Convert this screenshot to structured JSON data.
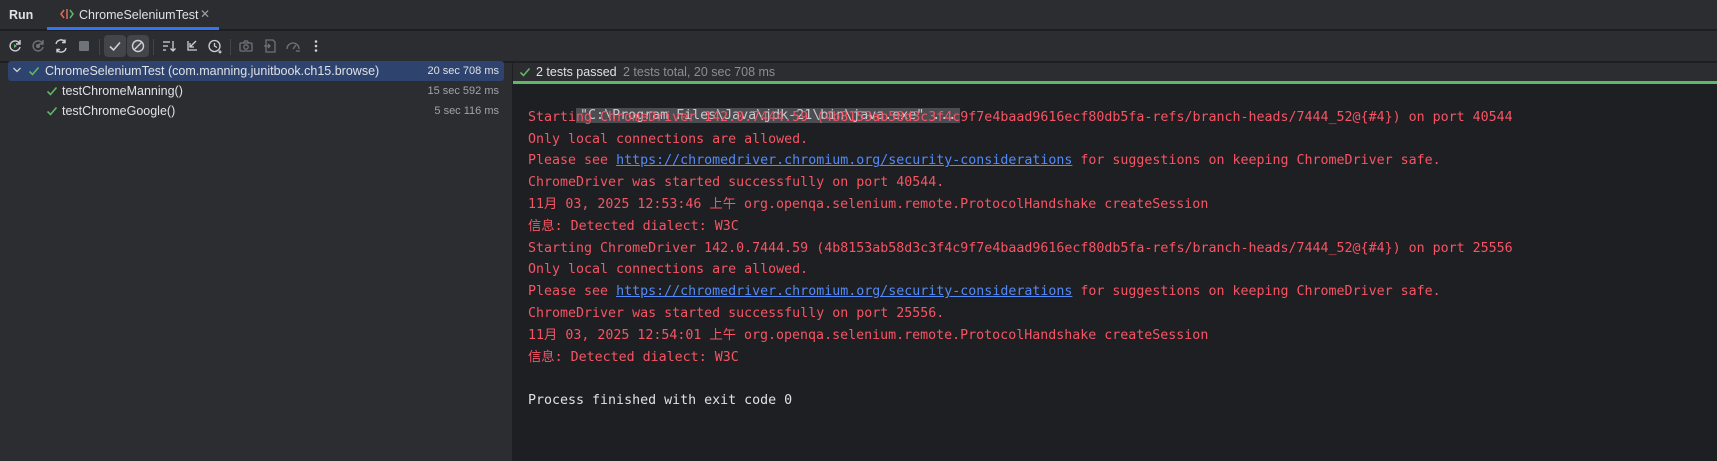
{
  "tabbar": {
    "run_label": "Run",
    "tab_title": "ChromeSeleniumTest",
    "close_glyph": "✕"
  },
  "toolbar": {
    "icons": [
      "rerun-icon",
      "rerun-failed-icon",
      "toggle-auto-test-icon",
      "stop-icon",
      "show-passed-icon",
      "show-ignored-icon",
      "sort-alphabetically-icon",
      "collapse-all-icon",
      "sort-by-duration-icon",
      "screenshot-icon",
      "import-tests-icon",
      "export-tests-icon",
      "more-options-icon"
    ]
  },
  "test_tree": {
    "root": {
      "label": "ChromeSeleniumTest (com.manning.junitbook.ch15.browse)",
      "duration": "20 sec 708 ms",
      "status": "passed"
    },
    "children": [
      {
        "label": "testChromeManning()",
        "duration": "15 sec 592 ms",
        "status": "passed"
      },
      {
        "label": "testChromeGoogle()",
        "duration": "5 sec 116 ms",
        "status": "passed"
      }
    ]
  },
  "status": {
    "passed": "2 tests passed",
    "total": "2 tests total, 20 sec 708 ms"
  },
  "console": {
    "command": "\"C:\\Program Files\\Java\\jdk-21\\bin\\java.exe\" ...",
    "lines": [
      {
        "type": "err",
        "text": "Starting ChromeDriver 142.0.7444.59 (4b8153ab58d3c3f4c9f7e4baad9616ecf80db5fa-refs/branch-heads/7444_52@{#4}) on port 40544"
      },
      {
        "type": "err",
        "text": "Only local connections are allowed."
      },
      {
        "type": "err-link",
        "before": "Please see ",
        "link": "https://chromedriver.chromium.org/security-considerations",
        "after": " for suggestions on keeping ChromeDriver safe."
      },
      {
        "type": "err",
        "text": "ChromeDriver was started successfully on port 40544."
      },
      {
        "type": "err",
        "text": "11月 03, 2025 12:53:46 上午 org.openqa.selenium.remote.ProtocolHandshake createSession"
      },
      {
        "type": "err",
        "text": "信息: Detected dialect: W3C"
      },
      {
        "type": "err",
        "text": "Starting ChromeDriver 142.0.7444.59 (4b8153ab58d3c3f4c9f7e4baad9616ecf80db5fa-refs/branch-heads/7444_52@{#4}) on port 25556"
      },
      {
        "type": "err",
        "text": "Only local connections are allowed."
      },
      {
        "type": "err-link",
        "before": "Please see ",
        "link": "https://chromedriver.chromium.org/security-considerations",
        "after": " for suggestions on keeping ChromeDriver safe."
      },
      {
        "type": "err",
        "text": "ChromeDriver was started successfully on port 25556."
      },
      {
        "type": "err",
        "text": "11月 03, 2025 12:54:01 上午 org.openqa.selenium.remote.ProtocolHandshake createSession"
      },
      {
        "type": "err",
        "text": "信息: Detected dialect: W3C"
      },
      {
        "type": "blank",
        "text": ""
      },
      {
        "type": "out",
        "text": "Process finished with exit code 0"
      }
    ]
  },
  "colors": {
    "accent": "#3574f0",
    "pass_green": "#5fb865",
    "stderr_red": "#f75464",
    "link_blue": "#548af7",
    "selection": "#2e436e"
  }
}
